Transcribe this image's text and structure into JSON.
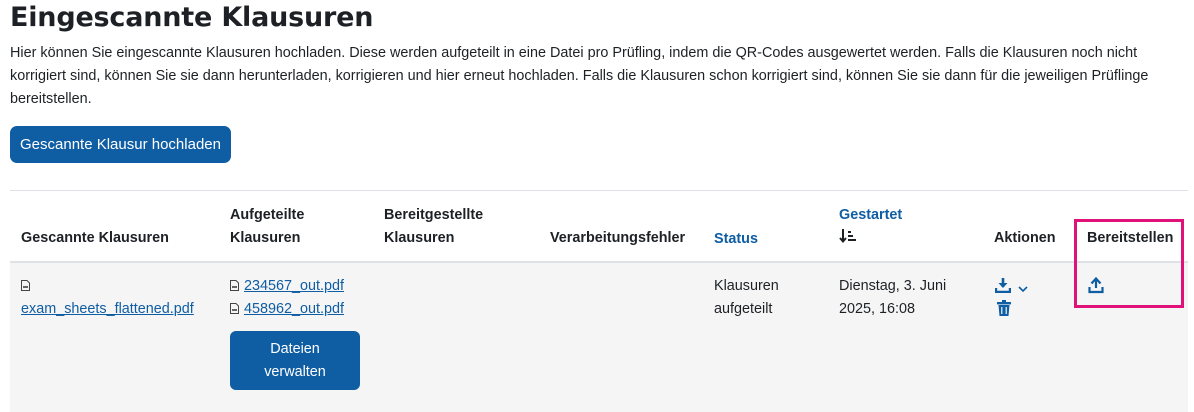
{
  "page": {
    "title": "Eingescannte Klausuren",
    "description": "Hier können Sie eingescannte Klausuren hochladen. Diese werden aufgeteilt in eine Datei pro Prüfling, indem die QR-Codes ausgewertet werden. Falls die Klausuren noch nicht korrigiert sind, können Sie sie dann herunterladen, korrigieren und hier erneut hochladen. Falls die Klausuren schon korrigiert sind, können Sie sie dann für die jeweiligen Prüflinge bereitstellen.",
    "upload_button": "Gescannte Klausur hochladen"
  },
  "table": {
    "headers": {
      "scanned": "Gescannte Klausuren",
      "split_1": "Aufgeteilte",
      "split_2": "Klausuren",
      "provided_1": "Bereitgestellte",
      "provided_2": "Klausuren",
      "errors": "Verarbeitungsfehler",
      "status": "Status",
      "started": "Gestartet",
      "actions": "Aktionen",
      "provide": "Bereitstellen"
    },
    "row": {
      "scanned_file": "exam_sheets_flattened.pdf",
      "split_files": [
        "234567_out.pdf",
        "458962_out.pdf"
      ],
      "manage_button_1": "Dateien",
      "manage_button_2": "verwalten",
      "status_1": "Klausuren",
      "status_2": "aufgeteilt",
      "started_1": "Dienstag, 3. Juni",
      "started_2": "2025, 16:08"
    }
  },
  "colors": {
    "primary": "#0f5da3",
    "highlight": "#e0127a",
    "row_bg": "#f5f5f5",
    "text": "#1d2125"
  },
  "icons": {
    "sort": "sort-descending-icon",
    "download": "download-icon",
    "chevron": "chevron-down-icon",
    "delete": "trash-icon",
    "provide": "upload-icon",
    "file": "pdf-file-icon"
  }
}
